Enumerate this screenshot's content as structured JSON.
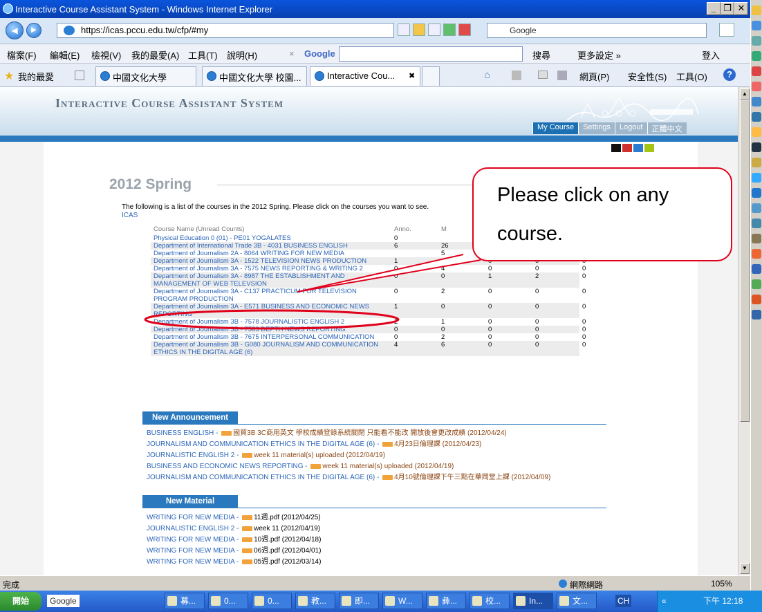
{
  "browser": {
    "window_title": "Interactive Course Assistant System - Windows Internet Explorer",
    "url": "https://icas.pccu.edu.tw/cfp/#my",
    "search_engine_label": "Google",
    "window_buttons": {
      "minimize": "_",
      "restore": "❐",
      "close": "✕"
    }
  },
  "menu": {
    "items": [
      "檔案(F)",
      "編輯(E)",
      "檢視(V)",
      "我的最愛(A)",
      "工具(T)",
      "說明(H)"
    ],
    "close_x": "×",
    "google_logo": "Google",
    "search_label": "搜尋",
    "more_settings": "更多設定 »",
    "login": "登入"
  },
  "favorites": {
    "label": "我的最愛",
    "tabs": [
      {
        "label": "中國文化大學"
      },
      {
        "label": "中國文化大學 校園..."
      },
      {
        "label": "Interactive Cou...",
        "close": "✖"
      }
    ],
    "cmd_page": "網頁(P)",
    "cmd_safety": "安全性(S)",
    "cmd_tools": "工具(O)"
  },
  "site": {
    "system_name": "Interactive Course Assistant System",
    "nav": [
      "My Course",
      "Settings",
      "Logout",
      "正體中文"
    ],
    "theme_colors": [
      "#111111",
      "#d0312d",
      "#2b7bd0",
      "#a6c414"
    ]
  },
  "page": {
    "term": "2012 Spring",
    "description": "The following is a list of the courses in the 2012 Spring. Please click on the courses you want to see.",
    "description_link": "ICAS",
    "columns": [
      "Course Name (Unread Counts)",
      "Anno.",
      "M",
      "",
      "",
      ""
    ],
    "courses": [
      {
        "name": "Physical Education 0 (01) - PE01 YOGALATES",
        "c": [
          "0",
          "",
          "",
          "",
          ""
        ]
      },
      {
        "name": "Department of International Trade 3B - 4031 BUSINESS ENGLISH",
        "c": [
          "6",
          "26",
          "",
          "",
          ""
        ]
      },
      {
        "name": "Department of Journalism 2A - 8064 WRITING FOR NEW MEDIA",
        "c": [
          "",
          "5",
          "0",
          "0",
          "0"
        ]
      },
      {
        "name": "Department of Journalism 3A - 1522 TELEVISION NEWS PRODUCTION",
        "c": [
          "1",
          "4",
          "0",
          "0",
          "0"
        ]
      },
      {
        "name": "Department of Journalism 3A - 7575 NEWS REPORTING & WRITING 2",
        "c": [
          "0",
          "4",
          "0",
          "0",
          "0"
        ]
      },
      {
        "name": "Department of Journalism 3A - 8987 THE ESTABLISHMENT AND MANAGEMENT OF WEB TELEVSION",
        "c": [
          "0",
          "0",
          "1",
          "2",
          "0"
        ]
      },
      {
        "name": "Department of Journalism 3A - C137 PRACTICUM FOR TELEVISION PROGRAM PRODUCTION",
        "c": [
          "0",
          "2",
          "0",
          "0",
          "0"
        ]
      },
      {
        "name": "Department of Journalism 3A - E571 BUSINESS AND ECONOMIC NEWS REPORTING",
        "c": [
          "1",
          "0",
          "0",
          "0",
          "0"
        ]
      },
      {
        "name": "Department of Journalism 3B - 7578 JOURNALISTIC ENGLISH 2",
        "c": [
          "2",
          "1",
          "0",
          "0",
          "0"
        ]
      },
      {
        "name": "Department of Journalism 3B - 7583 DEPTH NEWS REPORTING",
        "c": [
          "0",
          "0",
          "0",
          "0",
          "0"
        ]
      },
      {
        "name": "Department of Journalism 3B - 7675 INTERPERSONAL COMMUNICATION",
        "c": [
          "0",
          "2",
          "0",
          "0",
          "0"
        ]
      },
      {
        "name": "Department of Journalism 3B - G080 JOURNALISM AND COMMUNICATION ETHICS IN THE DIGITAL AGE (6)",
        "c": [
          "4",
          "6",
          "0",
          "0",
          "0"
        ]
      }
    ],
    "announcements_title": "New Announcement",
    "announcements": [
      {
        "course": "BUSINESS ENGLISH - ",
        "text": "國貿3B 3C商用英文 學校成績登錄系統關閉 只能看不能改 開放後會更改成績 (2012/04/24)"
      },
      {
        "course": "JOURNALISM AND COMMUNICATION ETHICS IN THE DIGITAL AGE (6) - ",
        "text": "4月23日倫理課 (2012/04/23)"
      },
      {
        "course": "JOURNALISTIC ENGLISH 2 - ",
        "text": "week 11 material(s) uploaded (2012/04/19)"
      },
      {
        "course": "BUSINESS AND ECONOMIC NEWS REPORTING - ",
        "text": "week 11 material(s) uploaded (2012/04/19)"
      },
      {
        "course": "JOURNALISM AND COMMUNICATION ETHICS IN THE DIGITAL AGE (6) - ",
        "text": "4月10號倫理課下午三點在華岡堂上課 (2012/04/09)"
      }
    ],
    "materials_title": "New Material",
    "materials": [
      {
        "course": "WRITING FOR NEW MEDIA - ",
        "text": "11週.pdf (2012/04/25)"
      },
      {
        "course": "JOURNALISTIC ENGLISH 2 - ",
        "text": "week 11 (2012/04/19)"
      },
      {
        "course": "WRITING FOR NEW MEDIA - ",
        "text": "10週.pdf (2012/04/18)"
      },
      {
        "course": "WRITING FOR NEW MEDIA - ",
        "text": "06週.pdf (2012/04/01)"
      },
      {
        "course": "WRITING FOR NEW MEDIA - ",
        "text": "05週.pdf (2012/03/14)"
      }
    ]
  },
  "callout": {
    "line1": "Please click on any",
    "line2": "course."
  },
  "statusbar": {
    "left": "完成",
    "zone": "網際網路",
    "zoom": "105%"
  },
  "taskbar": {
    "start": "開始",
    "google": "Google",
    "buttons": [
      "募...",
      "0...",
      "0...",
      "教...",
      "即...",
      "W...",
      "彝...",
      "校...",
      "In...",
      "文..."
    ],
    "lang": "CH",
    "clock": "下午 12:18"
  }
}
